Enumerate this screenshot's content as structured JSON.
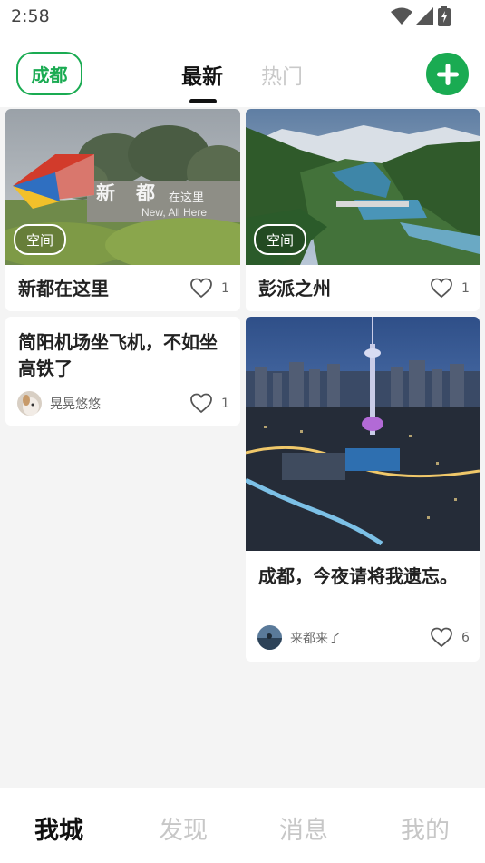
{
  "status_bar": {
    "time": "2:58",
    "icons": [
      "wifi-icon",
      "cellular-signal-icon",
      "battery-charging-icon"
    ]
  },
  "header": {
    "city": "成都",
    "tabs": [
      {
        "label": "最新",
        "active": true
      },
      {
        "label": "热门",
        "active": false
      }
    ],
    "add_icon": "plus-icon",
    "accent_color": "#1aab52"
  },
  "feed": {
    "cards": [
      {
        "title": "新都在这里",
        "badge": "空间",
        "likes": "1",
        "image_text": [
          "新",
          "都",
          "在这里",
          "New, All Here"
        ]
      },
      {
        "title": "彭派之州",
        "badge": "空间",
        "likes": "1"
      },
      {
        "title": "简阳机场坐飞机，不如坐高铁了",
        "author": "晃晃悠悠",
        "likes": "1"
      },
      {
        "title": "成都，今夜请将我遗忘。",
        "author": "来都来了",
        "likes": "6"
      }
    ]
  },
  "bottom_nav": {
    "items": [
      {
        "label": "我城",
        "active": true
      },
      {
        "label": "发现",
        "active": false
      },
      {
        "label": "消息",
        "active": false
      },
      {
        "label": "我的",
        "active": false
      }
    ]
  }
}
